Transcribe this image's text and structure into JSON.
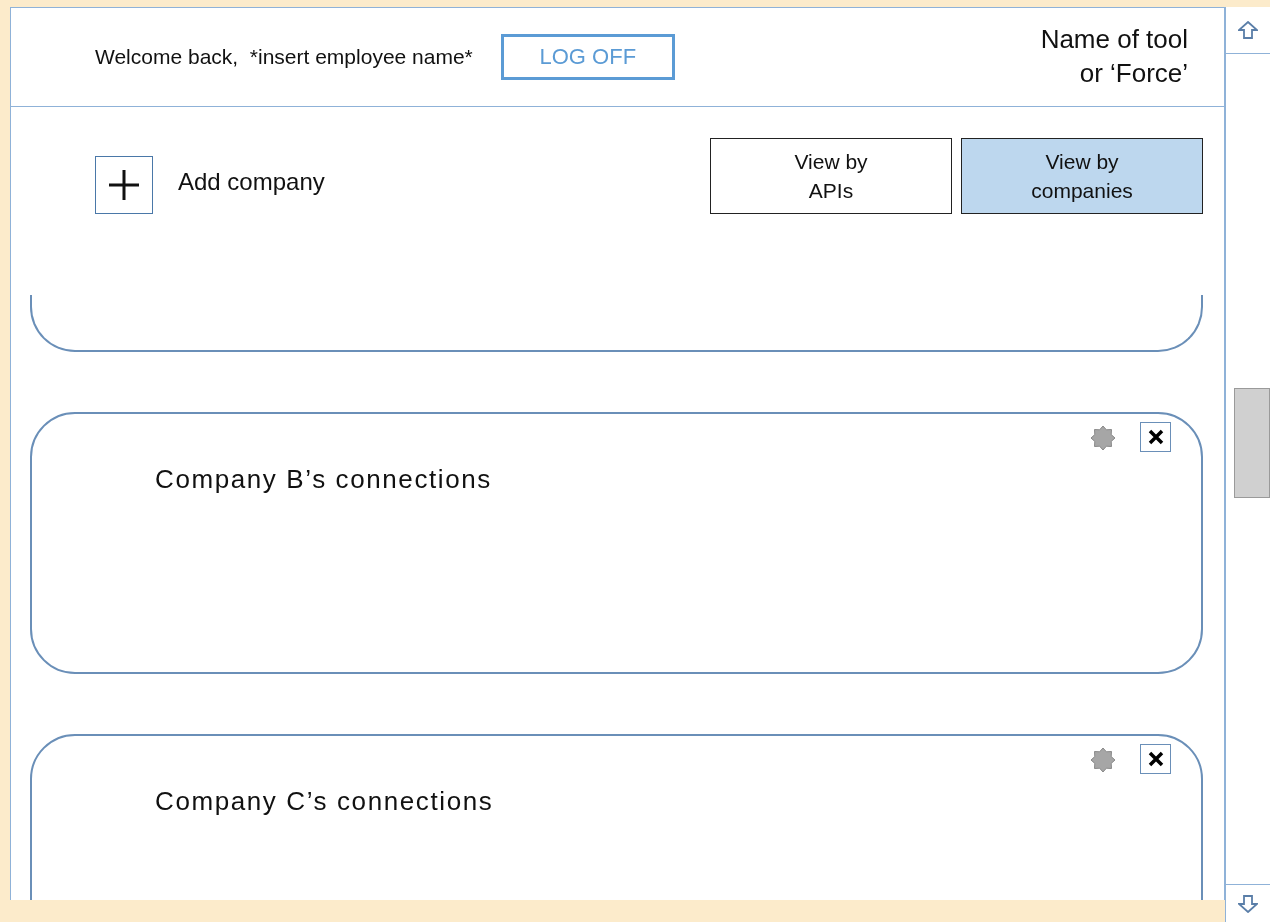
{
  "header": {
    "welcome": "Welcome back,  *insert employee name*",
    "log_off": "LOG OFF",
    "tool_name": "Name of tool\nor ‘Force’"
  },
  "toolbar": {
    "add_label": "Add company",
    "views": [
      {
        "label": "View by\nAPIs",
        "selected": false
      },
      {
        "label": "View by\ncompanies",
        "selected": true
      }
    ]
  },
  "cards": [
    {
      "kind": "cut"
    },
    {
      "kind": "full",
      "title": "Company B’s connections"
    },
    {
      "kind": "full",
      "title": "Company C’s connections"
    }
  ]
}
